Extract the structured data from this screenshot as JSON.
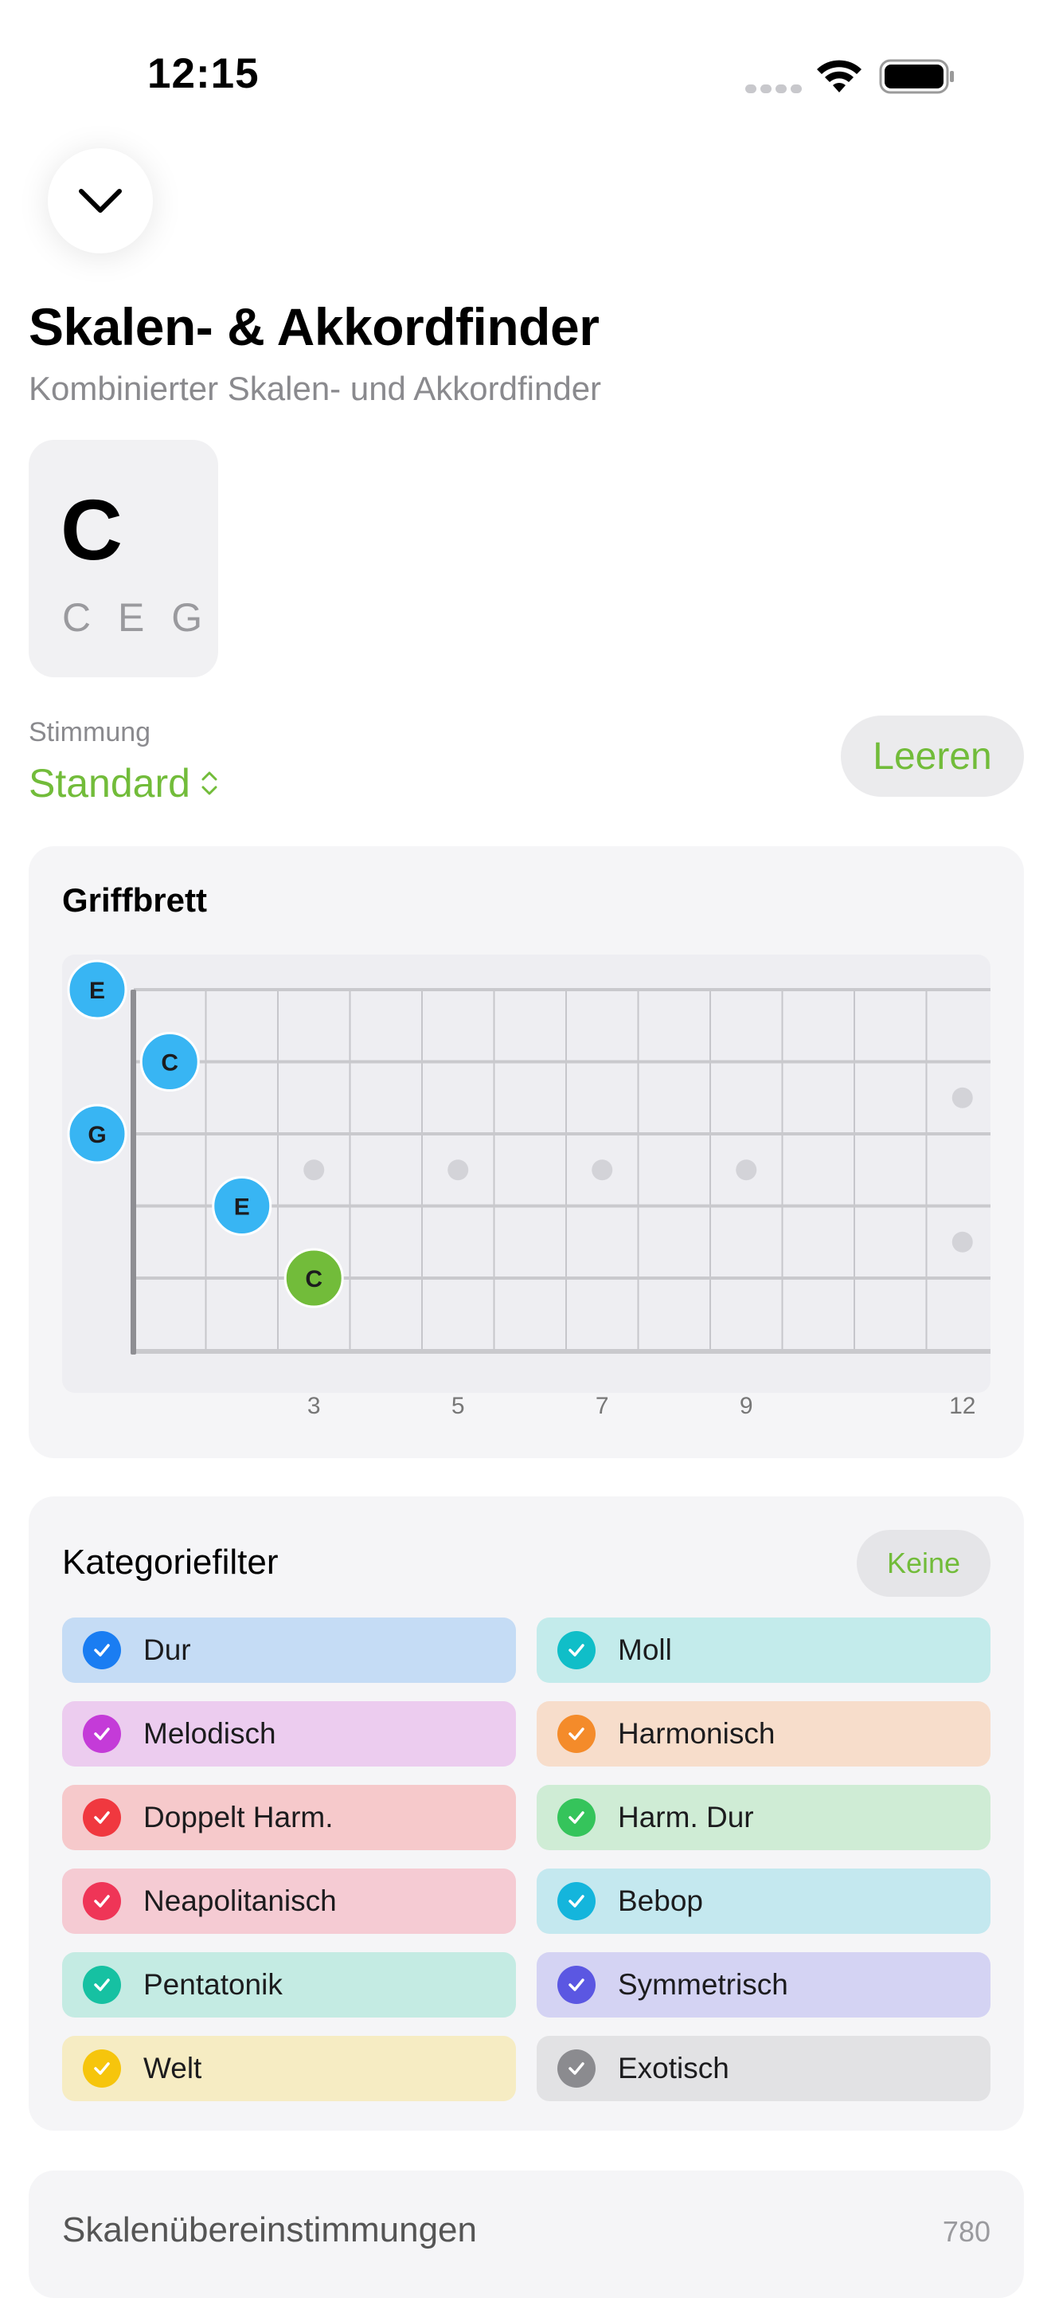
{
  "status_bar": {
    "time": "12:15"
  },
  "header": {
    "title": "Skalen- & Akkordfinder",
    "subtitle": "Kombinierter Skalen- und Akkordfinder"
  },
  "chord": {
    "name": "C",
    "notes": "C E G"
  },
  "tuning": {
    "label": "Stimmung",
    "value": "Standard"
  },
  "clear_button": "Leeren",
  "fretboard": {
    "title": "Griffbrett",
    "fret_labels": [
      "3",
      "5",
      "7",
      "9",
      "12"
    ],
    "notes": [
      {
        "label": "E",
        "string": 1,
        "fret": 0,
        "color": "#38b5f3"
      },
      {
        "label": "C",
        "string": 2,
        "fret": 1,
        "color": "#38b5f3"
      },
      {
        "label": "G",
        "string": 3,
        "fret": 0,
        "color": "#38b5f3"
      },
      {
        "label": "E",
        "string": 4,
        "fret": 2,
        "color": "#38b5f3"
      },
      {
        "label": "C",
        "string": 5,
        "fret": 3,
        "color": "#72bc3a"
      }
    ]
  },
  "category_filter": {
    "title": "Kategoriefilter",
    "none_button": "Keine",
    "items": [
      {
        "label": "Dur",
        "bg": "#c5dcf5",
        "accent": "#1a7df2"
      },
      {
        "label": "Moll",
        "bg": "#c3ebeb",
        "accent": "#10bec8"
      },
      {
        "label": "Melodisch",
        "bg": "#ecccef",
        "accent": "#c43bd8"
      },
      {
        "label": "Harmonisch",
        "bg": "#f7ddcb",
        "accent": "#f48b2a"
      },
      {
        "label": "Doppelt Harm.",
        "bg": "#f6c9cb",
        "accent": "#f0383f"
      },
      {
        "label": "Harm. Dur",
        "bg": "#cfecd5",
        "accent": "#35c45b"
      },
      {
        "label": "Neapolitanisch",
        "bg": "#f5cbd3",
        "accent": "#ef3557"
      },
      {
        "label": "Bebop",
        "bg": "#c4e8ef",
        "accent": "#14b5dc"
      },
      {
        "label": "Pentatonik",
        "bg": "#c4ebe3",
        "accent": "#16c1a2"
      },
      {
        "label": "Symmetrisch",
        "bg": "#d4d3f3",
        "accent": "#5b57e2"
      },
      {
        "label": "Welt",
        "bg": "#f6ecc3",
        "accent": "#f6c50c"
      },
      {
        "label": "Exotisch",
        "bg": "#e2e2e4",
        "accent": "#8b8b8f"
      }
    ]
  },
  "scale_matches": {
    "title": "Skalenübereinstimmungen",
    "count": "780"
  }
}
